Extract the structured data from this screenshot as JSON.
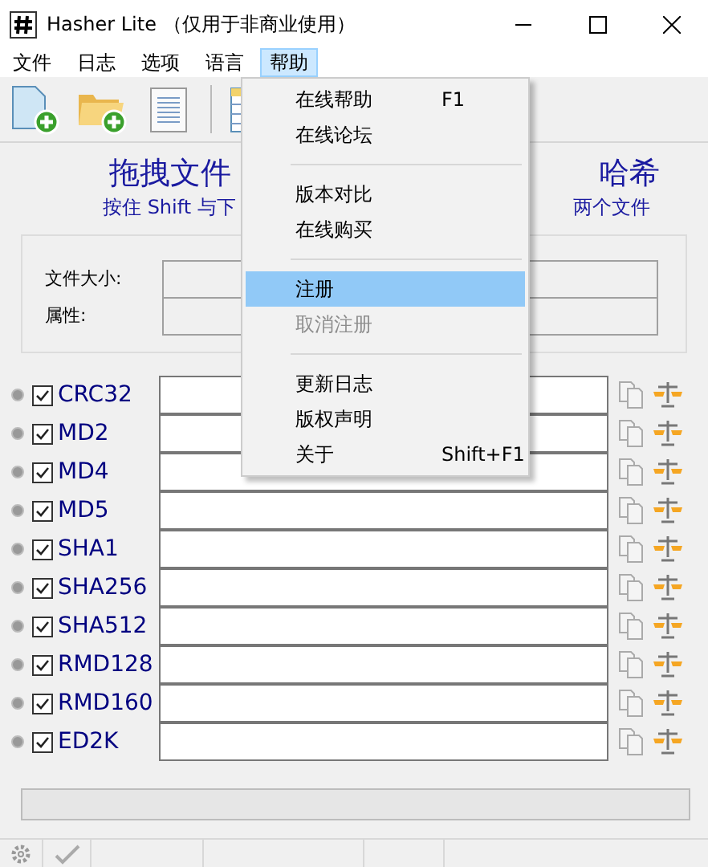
{
  "window": {
    "title": "Hasher Lite （仅用于非商业使用）"
  },
  "menubar": [
    {
      "label": "文件",
      "selected": false
    },
    {
      "label": "日志",
      "selected": false
    },
    {
      "label": "选项",
      "selected": false
    },
    {
      "label": "语言",
      "selected": false
    },
    {
      "label": "帮助",
      "selected": true
    }
  ],
  "heading": {
    "left": "拖拽文件",
    "right": "哈希"
  },
  "subheading": {
    "left": "按住 Shift 与下",
    "right": "两个文件"
  },
  "file_info": [
    {
      "label": "文件大小:"
    },
    {
      "label": "属性:"
    }
  ],
  "hashes": [
    {
      "name": "CRC32",
      "checked": true
    },
    {
      "name": "MD2",
      "checked": true
    },
    {
      "name": "MD4",
      "checked": true
    },
    {
      "name": "MD5",
      "checked": true
    },
    {
      "name": "SHA1",
      "checked": true
    },
    {
      "name": "SHA256",
      "checked": true
    },
    {
      "name": "SHA512",
      "checked": true
    },
    {
      "name": "RMD128",
      "checked": true
    },
    {
      "name": "RMD160",
      "checked": true
    },
    {
      "name": "ED2K",
      "checked": true
    }
  ],
  "progress": {
    "level": 0
  },
  "help_menu": [
    {
      "kind": "item",
      "label": "在线帮助",
      "shortcut": "F1",
      "selected": false,
      "disabled": false
    },
    {
      "kind": "item",
      "label": "在线论坛",
      "selected": false,
      "disabled": false
    },
    {
      "kind": "separator"
    },
    {
      "kind": "item",
      "label": "版本对比",
      "selected": false,
      "disabled": false
    },
    {
      "kind": "item",
      "label": "在线购买",
      "selected": false,
      "disabled": false
    },
    {
      "kind": "separator"
    },
    {
      "kind": "item",
      "label": "注册",
      "selected": true,
      "disabled": false
    },
    {
      "kind": "item",
      "label": "取消注册",
      "selected": false,
      "disabled": true
    },
    {
      "kind": "separator"
    },
    {
      "kind": "item",
      "label": "更新日志",
      "selected": false,
      "disabled": false
    },
    {
      "kind": "item",
      "label": "版权声明",
      "selected": false,
      "disabled": false
    },
    {
      "kind": "item",
      "label": "关于",
      "shortcut": "Shift+F1",
      "selected": false,
      "disabled": false
    }
  ]
}
